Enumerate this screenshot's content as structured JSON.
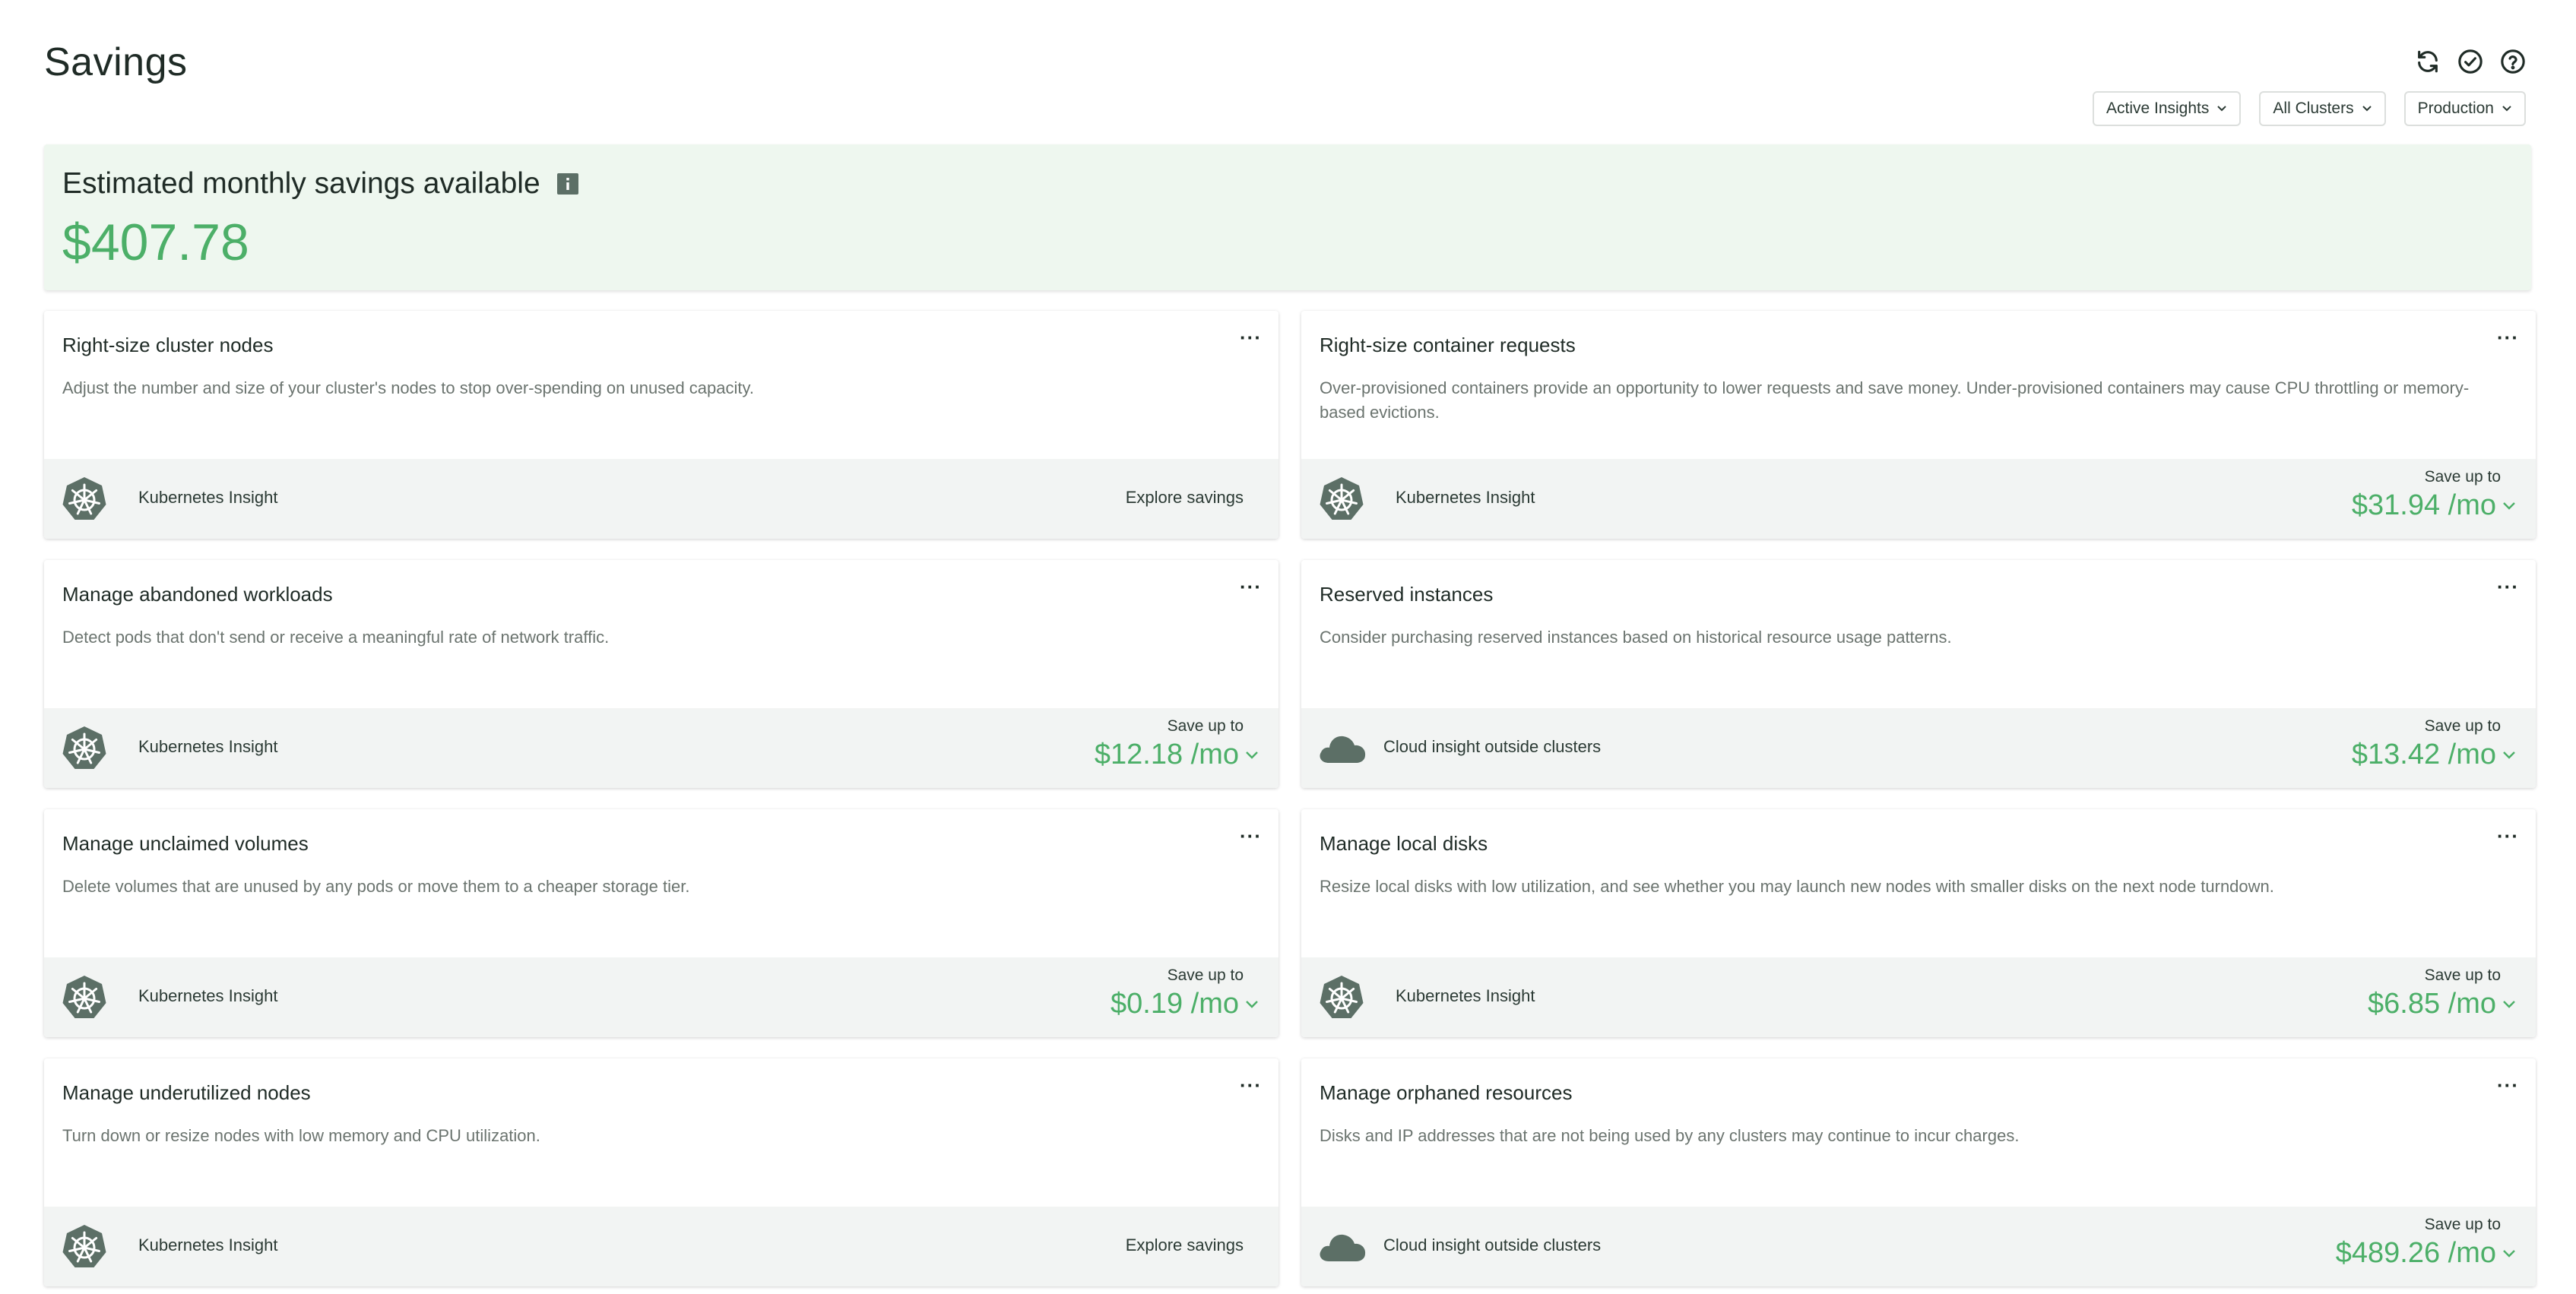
{
  "page": {
    "title": "Savings"
  },
  "header_icons": [
    "refresh-icon",
    "check-circle-icon",
    "help-icon"
  ],
  "filters": [
    {
      "label": "Active Insights"
    },
    {
      "label": "All Clusters"
    },
    {
      "label": "Production"
    }
  ],
  "summary": {
    "title": "Estimated monthly savings available",
    "value": "$407.78"
  },
  "cards": [
    {
      "title": "Right-size cluster nodes",
      "description": "Adjust the number and size of your cluster's nodes to stop over-spending on unused capacity.",
      "source": "Kubernetes Insight",
      "source_icon": "kubernetes-icon",
      "action": "Explore savings",
      "save_label": "",
      "save_value": ""
    },
    {
      "title": "Right-size container requests",
      "description": "Over-provisioned containers provide an opportunity to lower requests and save money. Under-provisioned containers may cause CPU throttling or memory-based evictions.",
      "source": "Kubernetes Insight",
      "source_icon": "kubernetes-icon",
      "action": "",
      "save_label": "Save up to",
      "save_value": "$31.94 /mo"
    },
    {
      "title": "Manage abandoned workloads",
      "description": "Detect pods that don't send or receive a meaningful rate of network traffic.",
      "source": "Kubernetes Insight",
      "source_icon": "kubernetes-icon",
      "action": "",
      "save_label": "Save up to",
      "save_value": "$12.18 /mo"
    },
    {
      "title": "Reserved instances",
      "description": "Consider purchasing reserved instances based on historical resource usage patterns.",
      "source": "Cloud insight outside clusters",
      "source_icon": "cloud-icon",
      "action": "",
      "save_label": "Save up to",
      "save_value": "$13.42 /mo"
    },
    {
      "title": "Manage unclaimed volumes",
      "description": "Delete volumes that are unused by any pods or move them to a cheaper storage tier.",
      "source": "Kubernetes Insight",
      "source_icon": "kubernetes-icon",
      "action": "",
      "save_label": "Save up to",
      "save_value": "$0.19 /mo"
    },
    {
      "title": "Manage local disks",
      "description": "Resize local disks with low utilization, and see whether you may launch new nodes with smaller disks on the next node turndown.",
      "source": "Kubernetes Insight",
      "source_icon": "kubernetes-icon",
      "action": "",
      "save_label": "Save up to",
      "save_value": "$6.85 /mo"
    },
    {
      "title": "Manage underutilized nodes",
      "description": "Turn down or resize nodes with low memory and CPU utilization.",
      "source": "Kubernetes Insight",
      "source_icon": "kubernetes-icon",
      "action": "Explore savings",
      "save_label": "",
      "save_value": ""
    },
    {
      "title": "Manage orphaned resources",
      "description": "Disks and IP addresses that are not being used by any clusters may continue to incur charges.",
      "source": "Cloud insight outside clusters",
      "source_icon": "cloud-icon",
      "action": "",
      "save_label": "Save up to",
      "save_value": "$489.26 /mo"
    }
  ],
  "colors": {
    "accent_green": "#4caf68",
    "summary_bg": "#eef7ef",
    "icon_dark": "#5c6f66",
    "footer_bg": "#f2f4f3"
  }
}
